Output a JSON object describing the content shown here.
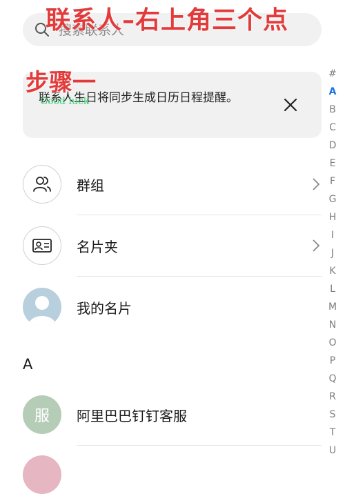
{
  "annotations": {
    "title": "联系人–右上角三个点",
    "step": "步骤一",
    "watermark": "Good luck"
  },
  "search": {
    "placeholder": "搜索联系人"
  },
  "banner": {
    "text": "联系人生日将同步生成日历日程提醒。"
  },
  "list": {
    "groups_label": "群组",
    "cards_label": "名片夹",
    "my_card_label": "我的名片"
  },
  "section": {
    "header": "A"
  },
  "contacts": [
    {
      "avatar_text": "服",
      "name": "阿里巴巴钉钉客服"
    }
  ],
  "index": [
    "#",
    "A",
    "B",
    "C",
    "D",
    "E",
    "F",
    "G",
    "H",
    "I",
    "J",
    "K",
    "L",
    "M",
    "N",
    "O",
    "P",
    "Q",
    "R",
    "S",
    "T",
    "U"
  ],
  "index_active": "A",
  "colors": {
    "overlay": "#e23b3b",
    "watermark": "#3fd17a",
    "index_active": "#1a73e8"
  }
}
